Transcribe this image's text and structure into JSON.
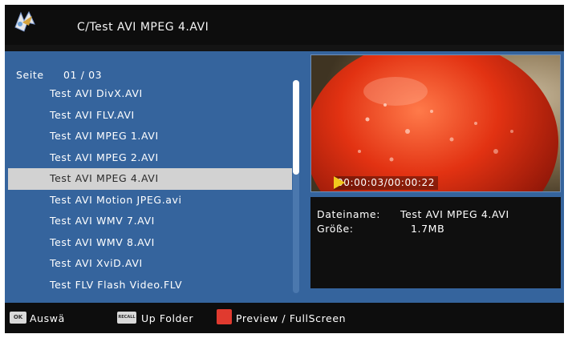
{
  "header": {
    "path": "C/Test AVI MPEG 4.AVI",
    "logo_icon": "media-player-logo-icon"
  },
  "list": {
    "page_label": "Seite",
    "page_value": "01 / 03",
    "items": [
      {
        "label": "Test AVI DivX.AVI"
      },
      {
        "label": "Test AVI FLV.AVI"
      },
      {
        "label": "Test AVI MPEG 1.AVI"
      },
      {
        "label": "Test AVI MPEG 2.AVI"
      },
      {
        "label": "Test AVI MPEG 4.AVI",
        "selected": true
      },
      {
        "label": "Test AVI Motion JPEG.avi"
      },
      {
        "label": "Test AVI WMV 7.AVI"
      },
      {
        "label": "Test AVI WMV 8.AVI"
      },
      {
        "label": "Test AVI XviD.AVI"
      },
      {
        "label": "Test FLV Flash Video.FLV"
      }
    ]
  },
  "preview": {
    "time": "00:00:03/00:00:22",
    "play_icon": "play-marker-icon"
  },
  "info": {
    "filename_label": "Dateiname:",
    "filename_value": "Test AVI MPEG 4.AVI",
    "size_label": "Größe:",
    "size_value": "1.7MB"
  },
  "footer": {
    "ok_key": "OK",
    "ok_label": "Auswä",
    "recall_key": "RECALL",
    "recall_label": "Up Folder",
    "red_label": "Preview / FullScreen"
  },
  "colors": {
    "panel": "#35649d",
    "selected": "#d2d2d2",
    "background": "#141414",
    "red_button": "#e03a2f",
    "play_marker": "#f2c81d"
  }
}
